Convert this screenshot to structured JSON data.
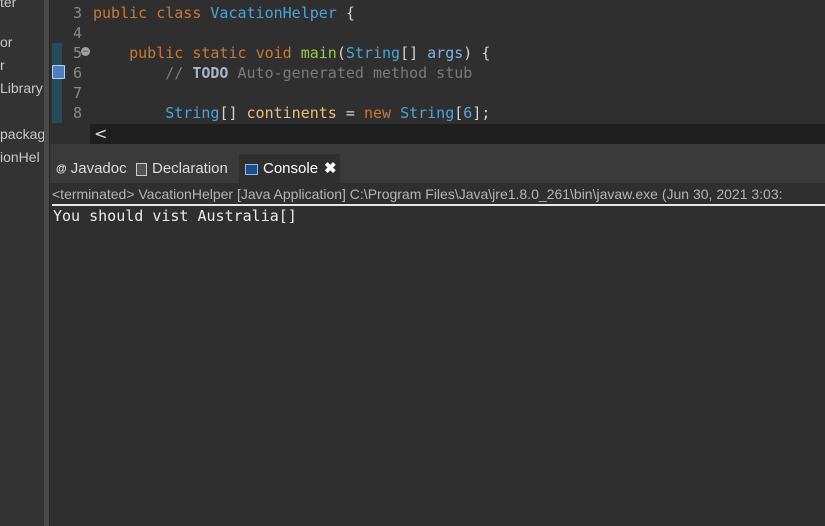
{
  "explorer": {
    "items": [
      "ter",
      "or",
      "r",
      "Library",
      "packag",
      "ionHel"
    ]
  },
  "editor": {
    "lines": [
      {
        "num": "3",
        "text": "public class VacationHelper {"
      },
      {
        "num": "4",
        "text": ""
      },
      {
        "num": "5",
        "text": "    public static void main(String[] args) {"
      },
      {
        "num": "6",
        "text": "        // TODO Auto-generated method stub"
      },
      {
        "num": "7",
        "text": ""
      },
      {
        "num": "8",
        "text": "        String[] continents = new String[6];"
      }
    ],
    "tokens": {
      "public": "public",
      "class": "class",
      "class_name": "VacationHelper",
      "open_brace": "{",
      "static": "static",
      "void": "void",
      "main": "main",
      "string": "String",
      "args": "args",
      "comment_slashes": "//",
      "todo": "TODO",
      "comment_rest": "Auto-generated method stub",
      "continents": "continents",
      "new": "new",
      "size": "6"
    },
    "scroll_arrow": "<"
  },
  "tabs": [
    {
      "label": "Javadoc",
      "icon": "at-sign-icon",
      "active": false
    },
    {
      "label": "Declaration",
      "icon": "declaration-icon",
      "active": false
    },
    {
      "label": "Console",
      "icon": "console-icon",
      "active": true,
      "close": "✖"
    }
  ],
  "console": {
    "header": "<terminated> VacationHelper [Java Application] C:\\Program Files\\Java\\jre1.8.0_261\\bin\\javaw.exe  (Jun 30, 2021 3:03:",
    "output": "You should vist Australia[]"
  },
  "colors": {
    "background": "#2f2f2f",
    "keyword": "#cc7832",
    "class": "#4aa4d8",
    "method": "#9ec94a",
    "variable": "#e5c07b"
  }
}
